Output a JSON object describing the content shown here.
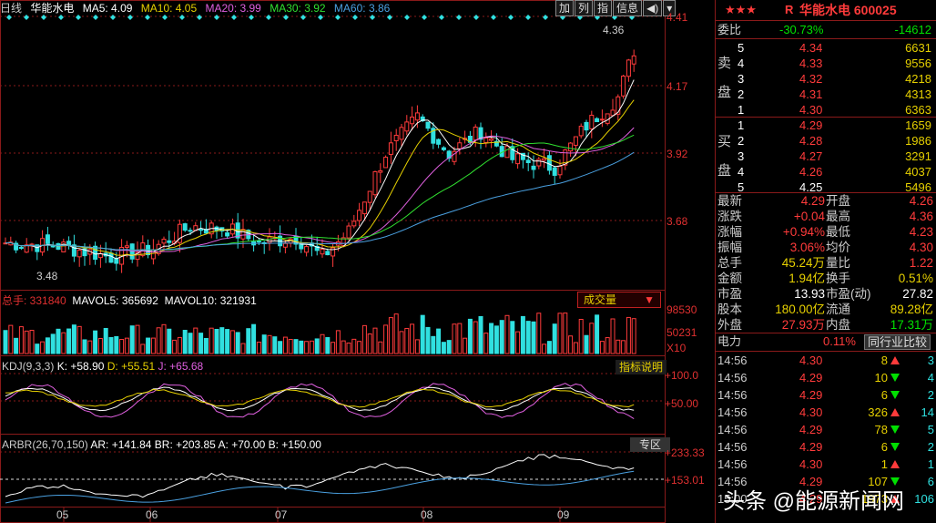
{
  "top": {
    "period": "日线",
    "stock": "华能水电",
    "ma5": "MA5: 4.09",
    "ma10": "MA10: 4.05",
    "ma20": "MA20: 3.99",
    "ma30": "MA30: 3.92",
    "ma60": "MA60: 3.86",
    "buttons": [
      "加",
      "列",
      "指",
      "信息"
    ]
  },
  "price_axis": [
    "4.41",
    "4.17",
    "3.92",
    "3.68"
  ],
  "annotations": {
    "high": "4.36",
    "low": "3.48"
  },
  "volume": {
    "header_total": "总手: 331840",
    "header_mavol5": "MAVOL5: 365692",
    "header_mavol10": "MAVOL10: 321931",
    "dropdown": "成交量",
    "axis_top": "98530",
    "axis_mid": "50231",
    "axis_unit": "X10"
  },
  "kdj": {
    "header": "KDJ(9,3,3)",
    "k": "K: +58.90",
    "d": "D: +55.51",
    "j": "J: +65.68",
    "button": "指标说明",
    "axis_top": "+100.0",
    "axis_mid": "+50.00"
  },
  "arbr": {
    "header": "ARBR(26,70,150)",
    "ar": "AR: +141.84",
    "br": "BR: +203.85",
    "a": "A: +70.00",
    "b": "B: +150.00",
    "button": "专区",
    "axis_top": "+233.33",
    "axis_mid": "+153.01"
  },
  "x_axis": [
    "05",
    "06",
    "07",
    "08",
    "09"
  ],
  "colors": {
    "up": "#ff3b3b",
    "down": "#30e0e0",
    "ma5": "#ffffff",
    "ma10": "#e6d000",
    "ma20": "#e060e0",
    "ma30": "#30e030",
    "ma60": "#4aa0e0"
  },
  "quote": {
    "stars": "★★★",
    "r_mark": "R",
    "title": "华能水电 600025",
    "weibi_label": "委比",
    "weibi_pct": "-30.73%",
    "weibi_val": "-14612",
    "sell_label_1": "卖",
    "sell_label_2": "盘",
    "buy_label_1": "买",
    "buy_label_2": "盘",
    "sell": [
      {
        "lv": "5",
        "price": "4.34",
        "vol": "6631"
      },
      {
        "lv": "4",
        "price": "4.33",
        "vol": "9556"
      },
      {
        "lv": "3",
        "price": "4.32",
        "vol": "4218"
      },
      {
        "lv": "2",
        "price": "4.31",
        "vol": "4313"
      },
      {
        "lv": "1",
        "price": "4.30",
        "vol": "6363"
      }
    ],
    "buy": [
      {
        "lv": "1",
        "price": "4.29",
        "vol": "1659"
      },
      {
        "lv": "2",
        "price": "4.28",
        "vol": "1986"
      },
      {
        "lv": "3",
        "price": "4.27",
        "vol": "3291"
      },
      {
        "lv": "4",
        "price": "4.26",
        "vol": "4037"
      },
      {
        "lv": "5",
        "price": "4.25",
        "vol": "5496"
      }
    ],
    "stats": [
      {
        "l1": "最新",
        "v1": "4.29",
        "c1": "red",
        "l2": "开盘",
        "v2": "4.26",
        "c2": "red"
      },
      {
        "l1": "涨跌",
        "v1": "+0.04",
        "c1": "red",
        "l2": "最高",
        "v2": "4.36",
        "c2": "red"
      },
      {
        "l1": "涨幅",
        "v1": "+0.94%",
        "c1": "red",
        "l2": "最低",
        "v2": "4.23",
        "c2": "red"
      },
      {
        "l1": "振幅",
        "v1": "3.06%",
        "c1": "red",
        "l2": "均价",
        "v2": "4.30",
        "c2": "red"
      },
      {
        "l1": "总手",
        "v1": "45.24万",
        "c1": "yellow",
        "l2": "量比",
        "v2": "1.22",
        "c2": "red"
      },
      {
        "l1": "金额",
        "v1": "1.94亿",
        "c1": "yellow",
        "l2": "换手",
        "v2": "0.51%",
        "c2": "yellow"
      },
      {
        "l1": "市盈",
        "v1": "13.93",
        "c1": "white",
        "l2": "市盈(动)",
        "v2": "27.82",
        "c2": "white"
      },
      {
        "l1": "股本",
        "v1": "180.00亿",
        "c1": "yellow",
        "l2": "流通",
        "v2": "89.28亿",
        "c2": "yellow"
      },
      {
        "l1": "外盘",
        "v1": "27.93万",
        "c1": "red",
        "l2": "内盘",
        "v2": "17.31万",
        "c2": "green"
      }
    ],
    "sector_name": "电力",
    "sector_pct": "0.11%",
    "compare_button": "同行业比较",
    "ticks": [
      {
        "t": "14:56",
        "p": "4.30",
        "v": "8",
        "dir": "up",
        "n": "3"
      },
      {
        "t": "14:56",
        "p": "4.29",
        "v": "10",
        "dir": "down",
        "n": "4"
      },
      {
        "t": "14:56",
        "p": "4.29",
        "v": "6",
        "dir": "down",
        "n": "2"
      },
      {
        "t": "14:56",
        "p": "4.30",
        "v": "326",
        "dir": "up",
        "n": "14"
      },
      {
        "t": "14:56",
        "p": "4.29",
        "v": "78",
        "dir": "down",
        "n": "5"
      },
      {
        "t": "14:56",
        "p": "4.29",
        "v": "6",
        "dir": "down",
        "n": "2"
      },
      {
        "t": "14:56",
        "p": "4.30",
        "v": "1",
        "dir": "up",
        "n": "1"
      },
      {
        "t": "14:56",
        "p": "4.29",
        "v": "107",
        "dir": "down",
        "n": "6"
      },
      {
        "t": "15:00",
        "p": "4.29",
        "v": "1973",
        "dir": "up",
        "n": "106"
      }
    ]
  },
  "watermark": "头条 @能源新闻网"
}
